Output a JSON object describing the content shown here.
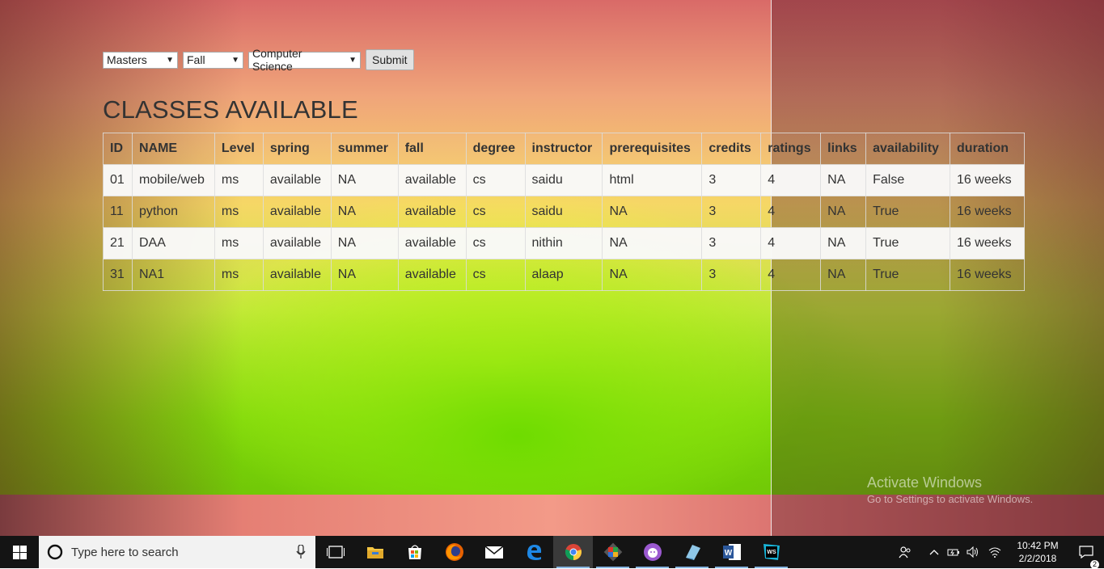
{
  "form": {
    "degree_value": "Masters",
    "term_value": "Fall",
    "department_value": "Computer Science",
    "submit_label": "Submit"
  },
  "heading": "CLASSES AVAILABLE",
  "table": {
    "headers": [
      "ID",
      "NAME",
      "Level",
      "spring",
      "summer",
      "fall",
      "degree",
      "instructor",
      "prerequisites",
      "credits",
      "ratings",
      "links",
      "availability",
      "duration"
    ],
    "rows": [
      [
        "01",
        "mobile/web",
        "ms",
        "available",
        "NA",
        "available",
        "cs",
        "saidu",
        "html",
        "3",
        "4",
        "NA",
        "False",
        "16 weeks"
      ],
      [
        "11",
        "python",
        "ms",
        "available",
        "NA",
        "available",
        "cs",
        "saidu",
        "NA",
        "3",
        "4",
        "NA",
        "True",
        "16 weeks"
      ],
      [
        "21",
        "DAA",
        "ms",
        "available",
        "NA",
        "available",
        "cs",
        "nithin",
        "NA",
        "3",
        "4",
        "NA",
        "True",
        "16 weeks"
      ],
      [
        "31",
        "NA1",
        "ms",
        "available",
        "NA",
        "available",
        "cs",
        "alaap",
        "NA",
        "3",
        "4",
        "NA",
        "True",
        "16 weeks"
      ]
    ]
  },
  "watermark": {
    "title": "Activate Windows",
    "subtitle": "Go to Settings to activate Windows."
  },
  "taskbar": {
    "search_placeholder": "Type here to search",
    "apps": [
      "task-view-icon",
      "file-explorer-icon",
      "store-icon",
      "firefox-icon",
      "mail-icon",
      "edge-icon",
      "chrome-icon",
      "git-icon",
      "github-desktop-icon",
      "notepad-icon",
      "word-icon",
      "webstorm-icon"
    ],
    "time": "10:42 PM",
    "date": "2/2/2018",
    "notification_count": "2"
  }
}
